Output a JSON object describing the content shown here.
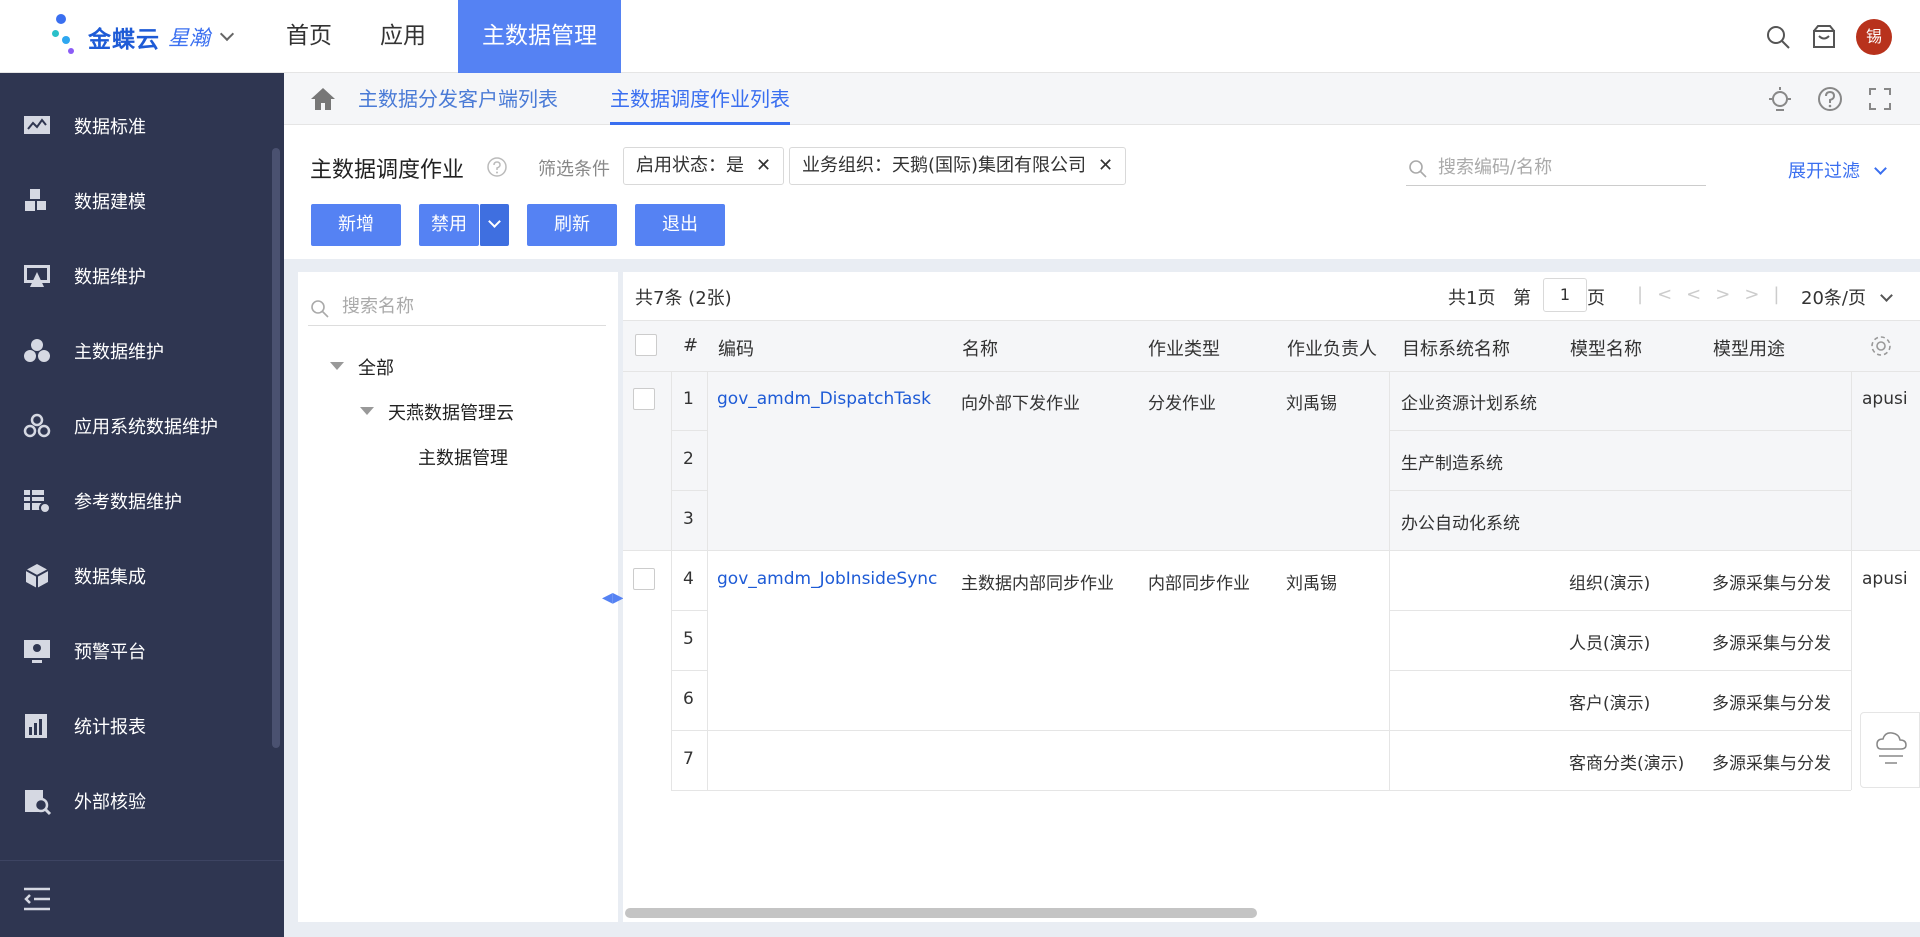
{
  "logo": {
    "brand": "金蝶云",
    "product": "星瀚"
  },
  "topnav": [
    {
      "label": "首页"
    },
    {
      "label": "应用"
    },
    {
      "label": "主数据管理"
    }
  ],
  "user": {
    "avatar_text": "锡"
  },
  "sidebar": {
    "items": [
      {
        "label": "数据标准"
      },
      {
        "label": "数据建模"
      },
      {
        "label": "数据维护"
      },
      {
        "label": "主数据维护"
      },
      {
        "label": "应用系统数据维护"
      },
      {
        "label": "参考数据维护"
      },
      {
        "label": "数据集成"
      },
      {
        "label": "预警平台"
      },
      {
        "label": "统计报表"
      },
      {
        "label": "外部核验"
      }
    ]
  },
  "tabs": [
    {
      "label": "主数据分发客户端列表"
    },
    {
      "label": "主数据调度作业列表"
    }
  ],
  "page": {
    "title": "主数据调度作业",
    "filter_label": "筛选条件",
    "chips": [
      {
        "label": "启用状态：是"
      },
      {
        "label": "业务组织：天鹅(国际)集团有限公司"
      }
    ],
    "search_placeholder": "搜索编码/名称",
    "expand_filter": "展开过滤"
  },
  "buttons": {
    "add": "新增",
    "disable": "禁用",
    "refresh": "刷新",
    "exit": "退出"
  },
  "tree": {
    "search_placeholder": "搜索名称",
    "nodes": [
      {
        "label": "全部"
      },
      {
        "label": "天燕数据管理云"
      },
      {
        "label": "主数据管理"
      }
    ]
  },
  "grid": {
    "summary": "共7条 (2张)",
    "total_pages": "共1页",
    "page_prefix": "第",
    "page_value": "1",
    "page_suffix": "页",
    "page_size": "20条/页",
    "columns": [
      "#",
      "编码",
      "名称",
      "作业类型",
      "作业负责人",
      "目标系统名称",
      "模型名称",
      "模型用途"
    ],
    "groups": [
      {
        "code": "gov_amdm_DispatchTask",
        "name": "向外部下发作业",
        "type": "分发作业",
        "owner": "刘禹锡",
        "extra": "apusi"
      },
      {
        "code": "gov_amdm_JobInsideSync",
        "name": "主数据内部同步作业",
        "type": "内部同步作业",
        "owner": "刘禹锡",
        "extra": "apusi"
      }
    ],
    "rows": [
      {
        "no": "1",
        "target": "企业资源计划系统",
        "model": "",
        "usage": ""
      },
      {
        "no": "2",
        "target": "生产制造系统",
        "model": "",
        "usage": ""
      },
      {
        "no": "3",
        "target": "办公自动化系统",
        "model": "",
        "usage": ""
      },
      {
        "no": "4",
        "target": "",
        "model": "组织(演示)",
        "usage": "多源采集与分发"
      },
      {
        "no": "5",
        "target": "",
        "model": "人员(演示)",
        "usage": "多源采集与分发"
      },
      {
        "no": "6",
        "target": "",
        "model": "客户(演示)",
        "usage": "多源采集与分发"
      },
      {
        "no": "7",
        "target": "",
        "model": "客商分类(演示)",
        "usage": "多源采集与分发"
      }
    ]
  }
}
